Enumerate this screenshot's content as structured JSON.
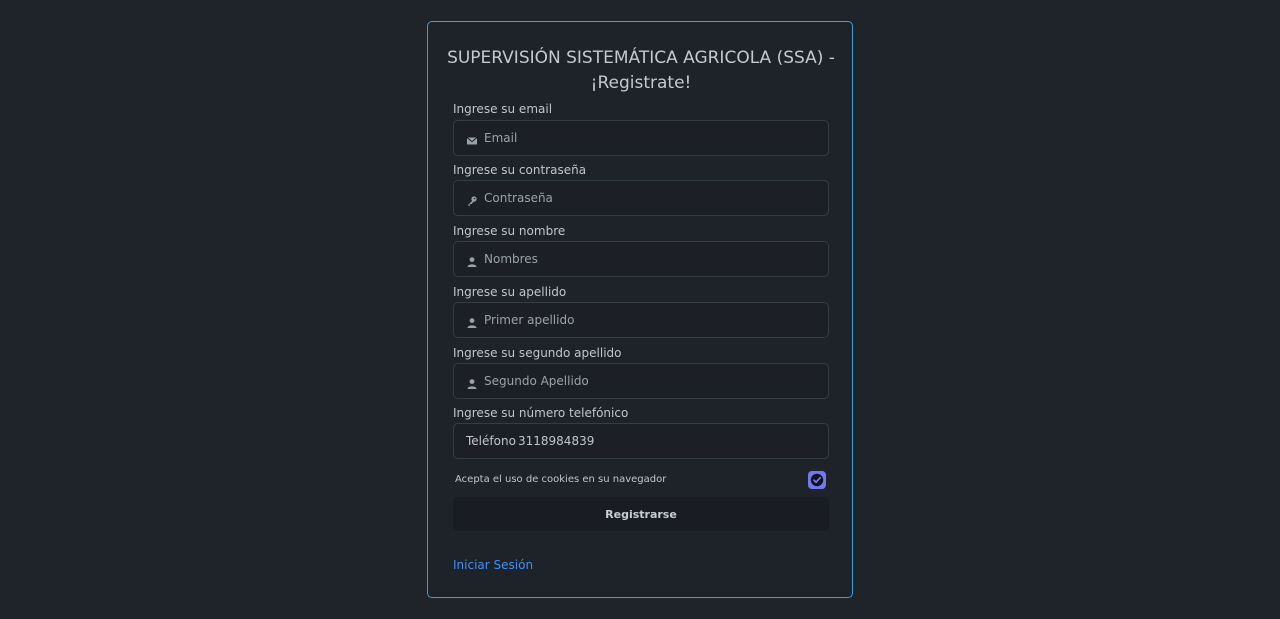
{
  "form": {
    "title": "SUPERVISIÓN SISTEMÁTICA AGRICOLA (SSA) - ¡Registrate!",
    "fields": [
      {
        "label": "Ingrese su email",
        "placeholder": "Email",
        "icon": "envelope-icon"
      },
      {
        "label": "Ingrese su contraseña",
        "placeholder": "Contraseña",
        "icon": "key-icon"
      },
      {
        "label": "Ingrese su nombre",
        "placeholder": "Nombres",
        "icon": "user-icon"
      },
      {
        "label": "Ingrese su apellido",
        "placeholder": "Primer apellido",
        "icon": "user-icon"
      },
      {
        "label": "Ingrese su segundo apellido",
        "placeholder": "Segundo Apellido",
        "icon": "user-icon"
      }
    ],
    "phone": {
      "label": "Ingrese su número telefónico",
      "prefix": "Teléfono",
      "value": "3118984839"
    },
    "cookies_label": "Acepta el uso de cookies en su navegador",
    "cookies_checked": true,
    "submit_label": "Registrarse",
    "login_link": "Iniciar Sesión"
  },
  "colors": {
    "background": "#1f242b",
    "card_border": "#3aa0d8",
    "checkbox": "#7278f0",
    "link": "#3e8ff5"
  }
}
